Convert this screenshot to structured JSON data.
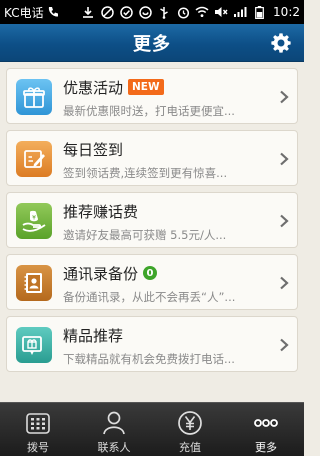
{
  "status_bar": {
    "carrier": "KC电话",
    "time": "10:2"
  },
  "header": {
    "title": "更多"
  },
  "items": [
    {
      "title": "优惠活动",
      "badge": "NEW",
      "subtitle": "最新优惠限时送，打电话更便宜...",
      "icon": "gift-icon",
      "color": "#3fa7e6"
    },
    {
      "title": "每日签到",
      "subtitle": "签到领话费,连续签到更有惊喜...",
      "icon": "checkin-icon",
      "color": "#e58b32"
    },
    {
      "title": "推荐赚话费",
      "subtitle": "邀请好友最高可获赠 5.5元/人...",
      "icon": "money-hand-icon",
      "color": "#6fb43a"
    },
    {
      "title": "通讯录备份",
      "badge": "0",
      "subtitle": "备份通讯录，从此不会再丢“人”...",
      "icon": "contacts-book-icon",
      "color": "#c97b2a"
    },
    {
      "title": "精品推荐",
      "subtitle": "下载精品就有机会免费拨打电话...",
      "icon": "recommend-icon",
      "color": "#3bb3a8"
    }
  ],
  "bottom_nav": [
    {
      "label": "拨号",
      "icon": "dialpad-icon"
    },
    {
      "label": "联系人",
      "icon": "contact-person-icon"
    },
    {
      "label": "充值",
      "icon": "yuan-recharge-icon"
    },
    {
      "label": "更多",
      "icon": "more-dots-icon",
      "active": true
    }
  ]
}
